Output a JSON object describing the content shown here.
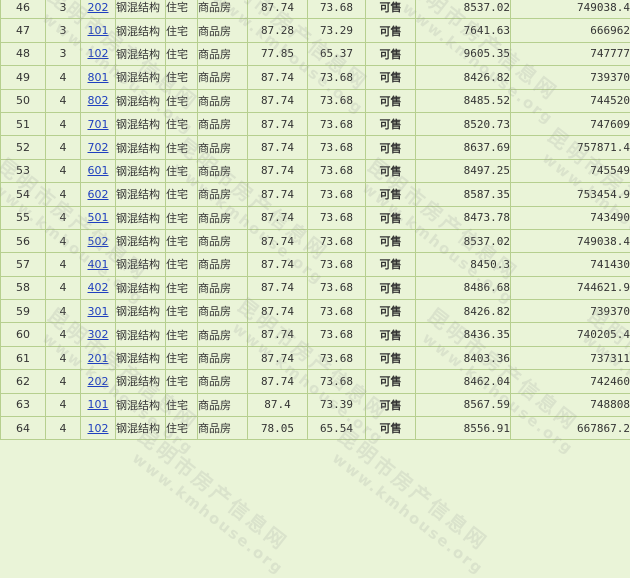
{
  "watermark": {
    "cn": "昆明市房产信息网",
    "en": "www.kmhouse.org"
  },
  "rows": [
    {
      "no": "46",
      "floor": "3",
      "room": "202",
      "structure": "钢混结构",
      "use": "住宅",
      "type": "商品房",
      "area_build": "87.74",
      "area_in": "73.68",
      "status": "可售",
      "unit_price": "8537.02",
      "total": "749038.4"
    },
    {
      "no": "47",
      "floor": "3",
      "room": "101",
      "structure": "钢混结构",
      "use": "住宅",
      "type": "商品房",
      "area_build": "87.28",
      "area_in": "73.29",
      "status": "可售",
      "unit_price": "7641.63",
      "total": "666962"
    },
    {
      "no": "48",
      "floor": "3",
      "room": "102",
      "structure": "钢混结构",
      "use": "住宅",
      "type": "商品房",
      "area_build": "77.85",
      "area_in": "65.37",
      "status": "可售",
      "unit_price": "9605.35",
      "total": "747777"
    },
    {
      "no": "49",
      "floor": "4",
      "room": "801",
      "structure": "钢混结构",
      "use": "住宅",
      "type": "商品房",
      "area_build": "87.74",
      "area_in": "73.68",
      "status": "可售",
      "unit_price": "8426.82",
      "total": "739370"
    },
    {
      "no": "50",
      "floor": "4",
      "room": "802",
      "structure": "钢混结构",
      "use": "住宅",
      "type": "商品房",
      "area_build": "87.74",
      "area_in": "73.68",
      "status": "可售",
      "unit_price": "8485.52",
      "total": "744520"
    },
    {
      "no": "51",
      "floor": "4",
      "room": "701",
      "structure": "钢混结构",
      "use": "住宅",
      "type": "商品房",
      "area_build": "87.74",
      "area_in": "73.68",
      "status": "可售",
      "unit_price": "8520.73",
      "total": "747609"
    },
    {
      "no": "52",
      "floor": "4",
      "room": "702",
      "structure": "钢混结构",
      "use": "住宅",
      "type": "商品房",
      "area_build": "87.74",
      "area_in": "73.68",
      "status": "可售",
      "unit_price": "8637.69",
      "total": "757871.4"
    },
    {
      "no": "53",
      "floor": "4",
      "room": "601",
      "structure": "钢混结构",
      "use": "住宅",
      "type": "商品房",
      "area_build": "87.74",
      "area_in": "73.68",
      "status": "可售",
      "unit_price": "8497.25",
      "total": "745549"
    },
    {
      "no": "54",
      "floor": "4",
      "room": "602",
      "structure": "钢混结构",
      "use": "住宅",
      "type": "商品房",
      "area_build": "87.74",
      "area_in": "73.68",
      "status": "可售",
      "unit_price": "8587.35",
      "total": "753454.9"
    },
    {
      "no": "55",
      "floor": "4",
      "room": "501",
      "structure": "钢混结构",
      "use": "住宅",
      "type": "商品房",
      "area_build": "87.74",
      "area_in": "73.68",
      "status": "可售",
      "unit_price": "8473.78",
      "total": "743490"
    },
    {
      "no": "56",
      "floor": "4",
      "room": "502",
      "structure": "钢混结构",
      "use": "住宅",
      "type": "商品房",
      "area_build": "87.74",
      "area_in": "73.68",
      "status": "可售",
      "unit_price": "8537.02",
      "total": "749038.4"
    },
    {
      "no": "57",
      "floor": "4",
      "room": "401",
      "structure": "钢混结构",
      "use": "住宅",
      "type": "商品房",
      "area_build": "87.74",
      "area_in": "73.68",
      "status": "可售",
      "unit_price": "8450.3",
      "total": "741430"
    },
    {
      "no": "58",
      "floor": "4",
      "room": "402",
      "structure": "钢混结构",
      "use": "住宅",
      "type": "商品房",
      "area_build": "87.74",
      "area_in": "73.68",
      "status": "可售",
      "unit_price": "8486.68",
      "total": "744621.9"
    },
    {
      "no": "59",
      "floor": "4",
      "room": "301",
      "structure": "钢混结构",
      "use": "住宅",
      "type": "商品房",
      "area_build": "87.74",
      "area_in": "73.68",
      "status": "可售",
      "unit_price": "8426.82",
      "total": "739370"
    },
    {
      "no": "60",
      "floor": "4",
      "room": "302",
      "structure": "钢混结构",
      "use": "住宅",
      "type": "商品房",
      "area_build": "87.74",
      "area_in": "73.68",
      "status": "可售",
      "unit_price": "8436.35",
      "total": "740205.4"
    },
    {
      "no": "61",
      "floor": "4",
      "room": "201",
      "structure": "钢混结构",
      "use": "住宅",
      "type": "商品房",
      "area_build": "87.74",
      "area_in": "73.68",
      "status": "可售",
      "unit_price": "8403.36",
      "total": "737311"
    },
    {
      "no": "62",
      "floor": "4",
      "room": "202",
      "structure": "钢混结构",
      "use": "住宅",
      "type": "商品房",
      "area_build": "87.74",
      "area_in": "73.68",
      "status": "可售",
      "unit_price": "8462.04",
      "total": "742460"
    },
    {
      "no": "63",
      "floor": "4",
      "room": "101",
      "structure": "钢混结构",
      "use": "住宅",
      "type": "商品房",
      "area_build": "87.4",
      "area_in": "73.39",
      "status": "可售",
      "unit_price": "8567.59",
      "total": "748808"
    },
    {
      "no": "64",
      "floor": "4",
      "room": "102",
      "structure": "钢混结构",
      "use": "住宅",
      "type": "商品房",
      "area_build": "78.05",
      "area_in": "65.54",
      "status": "可售",
      "unit_price": "8556.91",
      "total": "667867.2"
    }
  ]
}
